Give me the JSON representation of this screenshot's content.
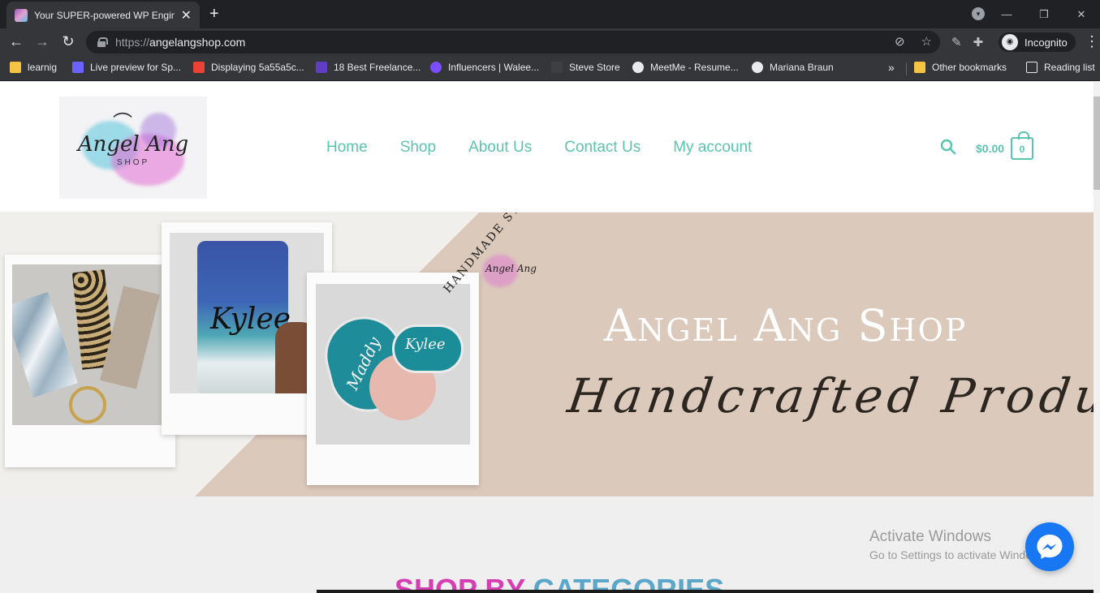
{
  "browser": {
    "tab_title": "Your SUPER-powered WP Engine",
    "url_scheme": "https://",
    "url_host": "angelangshop.com",
    "incognito_label": "Incognito",
    "bookmarks": [
      {
        "label": "learnig",
        "icon": "folder-icon",
        "color": "#f6c342"
      },
      {
        "label": "Live preview for Sp...",
        "icon": "preview-icon",
        "color": "#6c63ff"
      },
      {
        "label": "Displaying 5a55a5c...",
        "icon": "gmail-icon",
        "color": "#ea4335"
      },
      {
        "label": "18 Best Freelance...",
        "icon": "hired-icon",
        "color": "#5f3dc4"
      },
      {
        "label": "Influencers | Walee...",
        "icon": "link-icon",
        "color": "#7c4dff"
      },
      {
        "label": "Steve Store",
        "icon": "store-icon",
        "color": "#3c4043"
      },
      {
        "label": "MeetMe - Resume...",
        "icon": "globe-icon",
        "color": "#e8eaed"
      },
      {
        "label": "Mariana Braun",
        "icon": "globe-icon",
        "color": "#e8eaed"
      }
    ],
    "other_bookmarks": "Other bookmarks",
    "reading_list": "Reading list"
  },
  "site": {
    "logo_text": "Angel Ang",
    "logo_sub": "SHOP",
    "nav": [
      "Home",
      "Shop",
      "About Us",
      "Contact Us",
      "My account"
    ],
    "cart_total": "$0.00",
    "cart_count": "0",
    "accent_color": "#5bc4b0"
  },
  "hero": {
    "stamp_text": "HANDMADE STUDIO",
    "title": "Angel Ang Shop",
    "subtitle": "Handcrafted Products",
    "photo_text_tumbler": "Kylee",
    "photo_text_badge1": "Maddy",
    "photo_text_badge2": "Kylee"
  },
  "section": {
    "title_part1": "SHOP BY",
    "title_part2": "CATEGORIES"
  },
  "overlay": {
    "activate_title": "Activate Windows",
    "activate_sub": "Go to Settings to activate Windows."
  }
}
